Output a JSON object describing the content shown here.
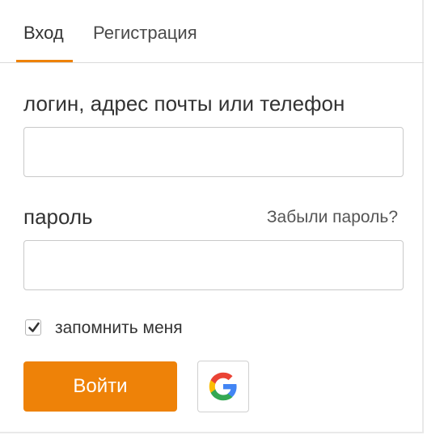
{
  "tabs": {
    "login_label": "Вход",
    "register_label": "Регистрация",
    "active_tab": "login"
  },
  "form": {
    "login_label": "логин, адрес почты или телефон",
    "login_value": "",
    "password_label": "пароль",
    "password_value": "",
    "forgot_password_label": "Забыли пароль?",
    "remember_label": "запомнить меня",
    "remember_checked": true,
    "submit_label": "Войти",
    "google_icon": "google-icon"
  },
  "colors": {
    "accent": "#ee8208",
    "google_blue": "#4285f4",
    "google_red": "#ea4335",
    "google_yellow": "#fbbc05",
    "google_green": "#34a853"
  }
}
